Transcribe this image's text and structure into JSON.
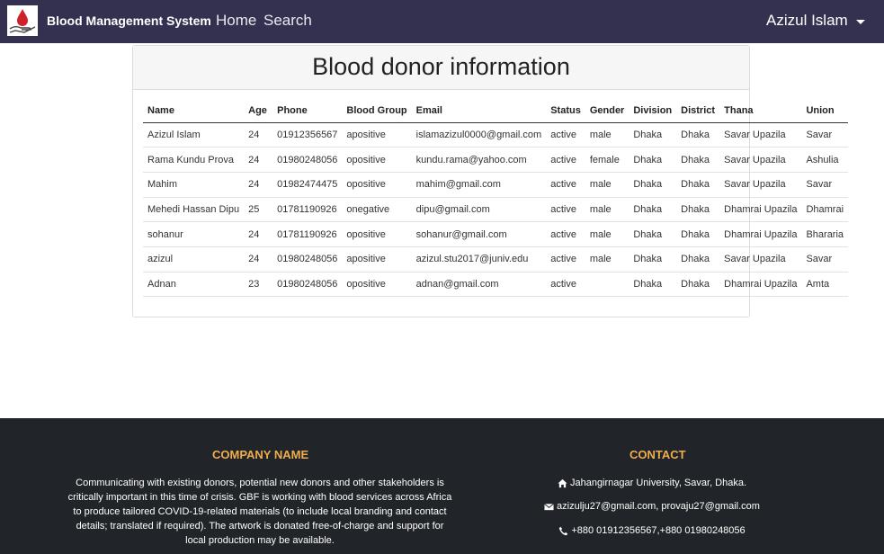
{
  "navbar": {
    "brand": "Blood Management System",
    "links": [
      "Home",
      "Search"
    ],
    "user_name": "Azizul Islam"
  },
  "card": {
    "title": "Blood donor information"
  },
  "table": {
    "headers": [
      "Name",
      "Age",
      "Phone",
      "Blood Group",
      "Email",
      "Status",
      "Gender",
      "Division",
      "District",
      "Thana",
      "Union"
    ],
    "rows": [
      [
        "Azizul Islam",
        "24",
        "01912356567",
        "apositive",
        "islamazizul0000@gmail.com",
        "active",
        "male",
        "Dhaka",
        "Dhaka",
        "Savar Upazila",
        "Savar"
      ],
      [
        "Rama Kundu Prova",
        "24",
        "01980248056",
        "opositive",
        "kundu.rama@yahoo.com",
        "active",
        "female",
        "Dhaka",
        "Dhaka",
        "Savar Upazila",
        "Ashulia"
      ],
      [
        "Mahim",
        "24",
        "01982474475",
        "opositive",
        "mahim@gmail.com",
        "active",
        "male",
        "Dhaka",
        "Dhaka",
        "Savar Upazila",
        "Savar"
      ],
      [
        "Mehedi Hassan Dipu",
        "25",
        "01781190926",
        "onegative",
        "dipu@gmail.com",
        "active",
        "male",
        "Dhaka",
        "Dhaka",
        "Dhamrai Upazila",
        "Dhamrai"
      ],
      [
        "sohanur",
        "24",
        "01781190926",
        "opositive",
        "sohanur@gmail.com",
        "active",
        "male",
        "Dhaka",
        "Dhaka",
        "Dhamrai Upazila",
        "Bhararia"
      ],
      [
        "azizul",
        "24",
        "01980248056",
        "apositive",
        "azizul.stu2017@juniv.edu",
        "active",
        "male",
        "Dhaka",
        "Dhaka",
        "Savar Upazila",
        "Savar"
      ],
      [
        "Adnan",
        "23",
        "01980248056",
        "opositive",
        "adnan@gmail.com",
        "active",
        "",
        "Dhaka",
        "Dhaka",
        "Dhamrai Upazila",
        "Amta"
      ]
    ]
  },
  "footer": {
    "company_heading": "COMPANY NAME",
    "company_text": "Communicating with existing donors, potential new donors and other stakeholders is critically important in this time of crisis. GBF is working with blood services across Africa to produce tailored COVID-19-related materials (to include local branding and contact details; translated if required). The artwork is donated free-of-charge and support for local production may be available.",
    "contact_heading": "CONTACT",
    "address": "Jahangirnagar University, Savar, Dhaka.",
    "emails": "azizulju27@gmail.com, provaju27@gmail.com",
    "phones": "+880 01912356567,+880 01980248056"
  },
  "colors": {
    "navbar_bg": "#343150",
    "footer_bg": "#212529",
    "footer_heading": "#f0ad4e",
    "logo_blood": "#d0202a"
  },
  "icons": [
    "blood-drop-hand-logo",
    "caret-down-icon",
    "home-icon",
    "envelope-icon",
    "phone-icon"
  ]
}
